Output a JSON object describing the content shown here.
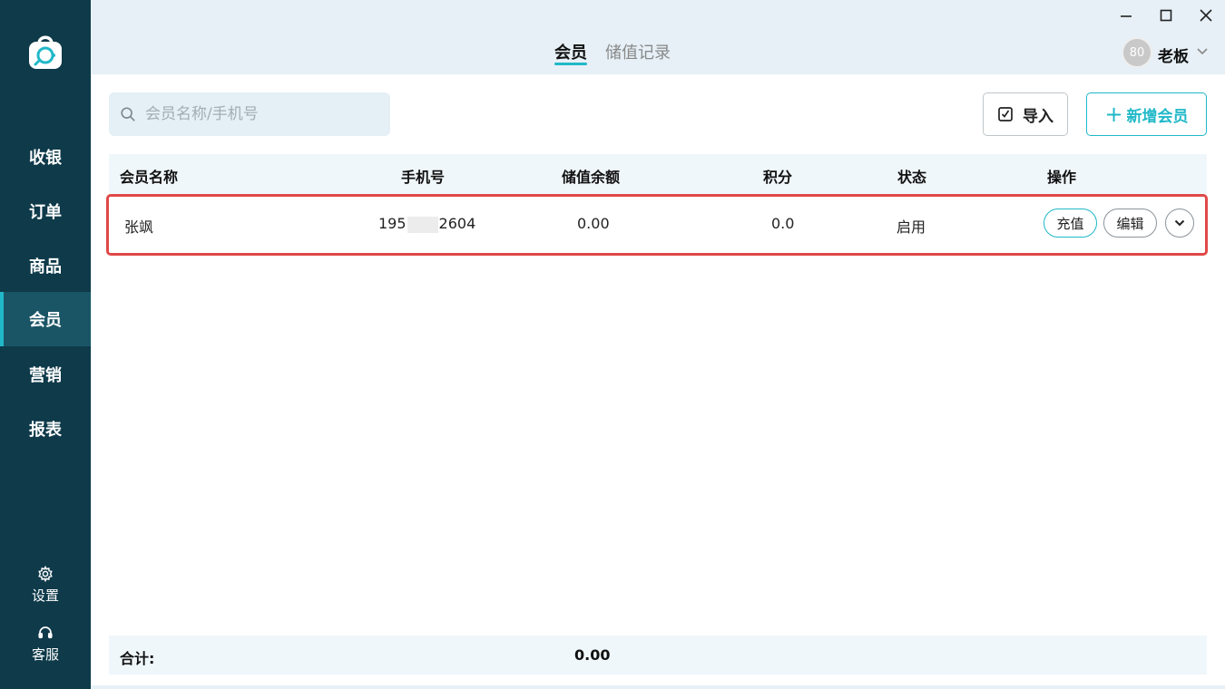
{
  "sidebar": {
    "logo_icon": "shopping-bag-logo-icon",
    "items": [
      {
        "label": "收银"
      },
      {
        "label": "订单"
      },
      {
        "label": "商品"
      },
      {
        "label": "会员",
        "active": true
      },
      {
        "label": "营销"
      },
      {
        "label": "报表"
      }
    ],
    "settings_label": "设置",
    "support_label": "客服"
  },
  "header": {
    "tabs": [
      {
        "label": "会员",
        "active": true
      },
      {
        "label": "储值记录"
      }
    ],
    "user": {
      "avatar_text": "80",
      "name": "老板"
    }
  },
  "toolbar": {
    "search_placeholder": "会员名称/手机号",
    "import_label": "导入",
    "add_label": "新增会员"
  },
  "table": {
    "columns": [
      "会员名称",
      "手机号",
      "储值余额",
      "积分",
      "状态",
      "操作"
    ],
    "rows": [
      {
        "name": "张飒",
        "phone_prefix": "195",
        "phone_suffix": "2604",
        "balance": "0.00",
        "points": "0.0",
        "status": "启用",
        "actions": {
          "recharge": "充值",
          "edit": "编辑"
        }
      }
    ],
    "footer": {
      "label": "合计:",
      "total_balance": "0.00"
    }
  },
  "colors": {
    "sidebar_bg": "#0e3a4a",
    "accent": "#20b8c8",
    "highlight_border": "#e04848"
  }
}
